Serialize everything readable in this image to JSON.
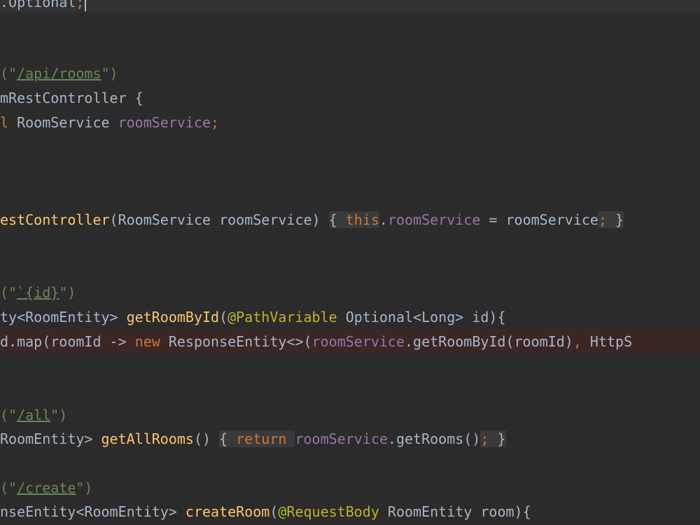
{
  "editor": {
    "lines": [
      {
        "tokens": [
          {
            "t": ".Optional",
            "c": "t-plain"
          },
          {
            "t": ";",
            "c": "t-semi"
          }
        ]
      },
      {
        "tokens": [
          {
            "t": "(\"",
            "c": "t-str"
          },
          {
            "t": "/api/rooms",
            "c": "t-link"
          },
          {
            "t": "\")",
            "c": "t-str"
          }
        ]
      },
      {
        "tokens": [
          {
            "t": "mRestController {",
            "c": "t-plain"
          }
        ]
      },
      {
        "tokens": [
          {
            "t": "l ",
            "c": "t-kw"
          },
          {
            "t": "RoomService ",
            "c": "t-plain"
          },
          {
            "t": "roomService",
            "c": "t-field"
          },
          {
            "t": ";",
            "c": "t-semi"
          }
        ]
      },
      {
        "tokens": [
          {
            "t": "estController",
            "c": "t-method"
          },
          {
            "t": "(RoomService roomService) ",
            "c": "t-plain"
          },
          {
            "t": "{ ",
            "c": "t-fold"
          },
          {
            "t": "this",
            "c": "t-foldkw"
          },
          {
            "t": ".",
            "c": "t-plain"
          },
          {
            "t": "roomService",
            "c": "t-field"
          },
          {
            "t": " = roomService",
            "c": "t-plain"
          },
          {
            "t": ";",
            "c": "t-foldkw"
          },
          {
            "t": " }",
            "c": "t-fold"
          }
        ]
      },
      {
        "tokens": [
          {
            "t": "(\"",
            "c": "t-str"
          },
          {
            "t": "`{id}",
            "c": "t-link"
          },
          {
            "t": "\")",
            "c": "t-str"
          }
        ]
      },
      {
        "tokens": [
          {
            "t": "ty<RoomEntity> ",
            "c": "t-plain"
          },
          {
            "t": "getRoomById",
            "c": "t-method"
          },
          {
            "t": "(",
            "c": "t-plain"
          },
          {
            "t": "@PathVariable",
            "c": "t-anno"
          },
          {
            "t": " Optional<Long> id){",
            "c": "t-plain"
          }
        ]
      },
      {
        "tokens": [
          {
            "t": "d.map(roomId -> ",
            "c": "t-plain"
          },
          {
            "t": "new ",
            "c": "t-kw"
          },
          {
            "t": "ResponseEntity<>(",
            "c": "t-plain"
          },
          {
            "t": "roomService",
            "c": "t-field"
          },
          {
            "t": ".getRoomById(roomId)",
            "c": "t-plain"
          },
          {
            "t": ", ",
            "c": "t-kw"
          },
          {
            "t": "HttpS",
            "c": "t-plain"
          }
        ]
      },
      {
        "tokens": [
          {
            "t": "(\"",
            "c": "t-str"
          },
          {
            "t": "/all",
            "c": "t-link"
          },
          {
            "t": "\")",
            "c": "t-str"
          }
        ]
      },
      {
        "tokens": [
          {
            "t": "RoomEntity> ",
            "c": "t-plain"
          },
          {
            "t": "getAllRooms",
            "c": "t-method"
          },
          {
            "t": "() ",
            "c": "t-plain"
          },
          {
            "t": "{ ",
            "c": "t-fold"
          },
          {
            "t": "return ",
            "c": "t-foldkw"
          },
          {
            "t": "roomService",
            "c": "t-field"
          },
          {
            "t": ".getRooms()",
            "c": "t-plain"
          },
          {
            "t": ";",
            "c": "t-foldkw"
          },
          {
            "t": " }",
            "c": "t-fold"
          }
        ]
      },
      {
        "tokens": [
          {
            "t": "(\"",
            "c": "t-str"
          },
          {
            "t": "/create",
            "c": "t-link"
          },
          {
            "t": "\")",
            "c": "t-str"
          }
        ]
      },
      {
        "tokens": [
          {
            "t": "nseEntity<RoomEntity> ",
            "c": "t-plain"
          },
          {
            "t": "createRoom",
            "c": "t-method"
          },
          {
            "t": "(",
            "c": "t-plain"
          },
          {
            "t": "@RequestBody",
            "c": "t-anno"
          },
          {
            "t": " RoomEntity room){",
            "c": "t-plain"
          }
        ]
      }
    ]
  }
}
